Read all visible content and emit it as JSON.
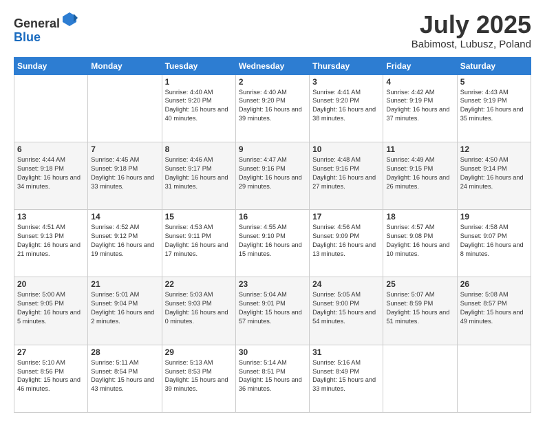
{
  "header": {
    "logo_general": "General",
    "logo_blue": "Blue",
    "month_title": "July 2025",
    "subtitle": "Babimost, Lubusz, Poland"
  },
  "days_of_week": [
    "Sunday",
    "Monday",
    "Tuesday",
    "Wednesday",
    "Thursday",
    "Friday",
    "Saturday"
  ],
  "weeks": [
    [
      {
        "day": "",
        "info": ""
      },
      {
        "day": "",
        "info": ""
      },
      {
        "day": "1",
        "info": "Sunrise: 4:40 AM\nSunset: 9:20 PM\nDaylight: 16 hours\nand 40 minutes."
      },
      {
        "day": "2",
        "info": "Sunrise: 4:40 AM\nSunset: 9:20 PM\nDaylight: 16 hours\nand 39 minutes."
      },
      {
        "day": "3",
        "info": "Sunrise: 4:41 AM\nSunset: 9:20 PM\nDaylight: 16 hours\nand 38 minutes."
      },
      {
        "day": "4",
        "info": "Sunrise: 4:42 AM\nSunset: 9:19 PM\nDaylight: 16 hours\nand 37 minutes."
      },
      {
        "day": "5",
        "info": "Sunrise: 4:43 AM\nSunset: 9:19 PM\nDaylight: 16 hours\nand 35 minutes."
      }
    ],
    [
      {
        "day": "6",
        "info": "Sunrise: 4:44 AM\nSunset: 9:18 PM\nDaylight: 16 hours\nand 34 minutes."
      },
      {
        "day": "7",
        "info": "Sunrise: 4:45 AM\nSunset: 9:18 PM\nDaylight: 16 hours\nand 33 minutes."
      },
      {
        "day": "8",
        "info": "Sunrise: 4:46 AM\nSunset: 9:17 PM\nDaylight: 16 hours\nand 31 minutes."
      },
      {
        "day": "9",
        "info": "Sunrise: 4:47 AM\nSunset: 9:16 PM\nDaylight: 16 hours\nand 29 minutes."
      },
      {
        "day": "10",
        "info": "Sunrise: 4:48 AM\nSunset: 9:16 PM\nDaylight: 16 hours\nand 27 minutes."
      },
      {
        "day": "11",
        "info": "Sunrise: 4:49 AM\nSunset: 9:15 PM\nDaylight: 16 hours\nand 26 minutes."
      },
      {
        "day": "12",
        "info": "Sunrise: 4:50 AM\nSunset: 9:14 PM\nDaylight: 16 hours\nand 24 minutes."
      }
    ],
    [
      {
        "day": "13",
        "info": "Sunrise: 4:51 AM\nSunset: 9:13 PM\nDaylight: 16 hours\nand 21 minutes."
      },
      {
        "day": "14",
        "info": "Sunrise: 4:52 AM\nSunset: 9:12 PM\nDaylight: 16 hours\nand 19 minutes."
      },
      {
        "day": "15",
        "info": "Sunrise: 4:53 AM\nSunset: 9:11 PM\nDaylight: 16 hours\nand 17 minutes."
      },
      {
        "day": "16",
        "info": "Sunrise: 4:55 AM\nSunset: 9:10 PM\nDaylight: 16 hours\nand 15 minutes."
      },
      {
        "day": "17",
        "info": "Sunrise: 4:56 AM\nSunset: 9:09 PM\nDaylight: 16 hours\nand 13 minutes."
      },
      {
        "day": "18",
        "info": "Sunrise: 4:57 AM\nSunset: 9:08 PM\nDaylight: 16 hours\nand 10 minutes."
      },
      {
        "day": "19",
        "info": "Sunrise: 4:58 AM\nSunset: 9:07 PM\nDaylight: 16 hours\nand 8 minutes."
      }
    ],
    [
      {
        "day": "20",
        "info": "Sunrise: 5:00 AM\nSunset: 9:05 PM\nDaylight: 16 hours\nand 5 minutes."
      },
      {
        "day": "21",
        "info": "Sunrise: 5:01 AM\nSunset: 9:04 PM\nDaylight: 16 hours\nand 2 minutes."
      },
      {
        "day": "22",
        "info": "Sunrise: 5:03 AM\nSunset: 9:03 PM\nDaylight: 16 hours\nand 0 minutes."
      },
      {
        "day": "23",
        "info": "Sunrise: 5:04 AM\nSunset: 9:01 PM\nDaylight: 15 hours\nand 57 minutes."
      },
      {
        "day": "24",
        "info": "Sunrise: 5:05 AM\nSunset: 9:00 PM\nDaylight: 15 hours\nand 54 minutes."
      },
      {
        "day": "25",
        "info": "Sunrise: 5:07 AM\nSunset: 8:59 PM\nDaylight: 15 hours\nand 51 minutes."
      },
      {
        "day": "26",
        "info": "Sunrise: 5:08 AM\nSunset: 8:57 PM\nDaylight: 15 hours\nand 49 minutes."
      }
    ],
    [
      {
        "day": "27",
        "info": "Sunrise: 5:10 AM\nSunset: 8:56 PM\nDaylight: 15 hours\nand 46 minutes."
      },
      {
        "day": "28",
        "info": "Sunrise: 5:11 AM\nSunset: 8:54 PM\nDaylight: 15 hours\nand 43 minutes."
      },
      {
        "day": "29",
        "info": "Sunrise: 5:13 AM\nSunset: 8:53 PM\nDaylight: 15 hours\nand 39 minutes."
      },
      {
        "day": "30",
        "info": "Sunrise: 5:14 AM\nSunset: 8:51 PM\nDaylight: 15 hours\nand 36 minutes."
      },
      {
        "day": "31",
        "info": "Sunrise: 5:16 AM\nSunset: 8:49 PM\nDaylight: 15 hours\nand 33 minutes."
      },
      {
        "day": "",
        "info": ""
      },
      {
        "day": "",
        "info": ""
      }
    ]
  ]
}
